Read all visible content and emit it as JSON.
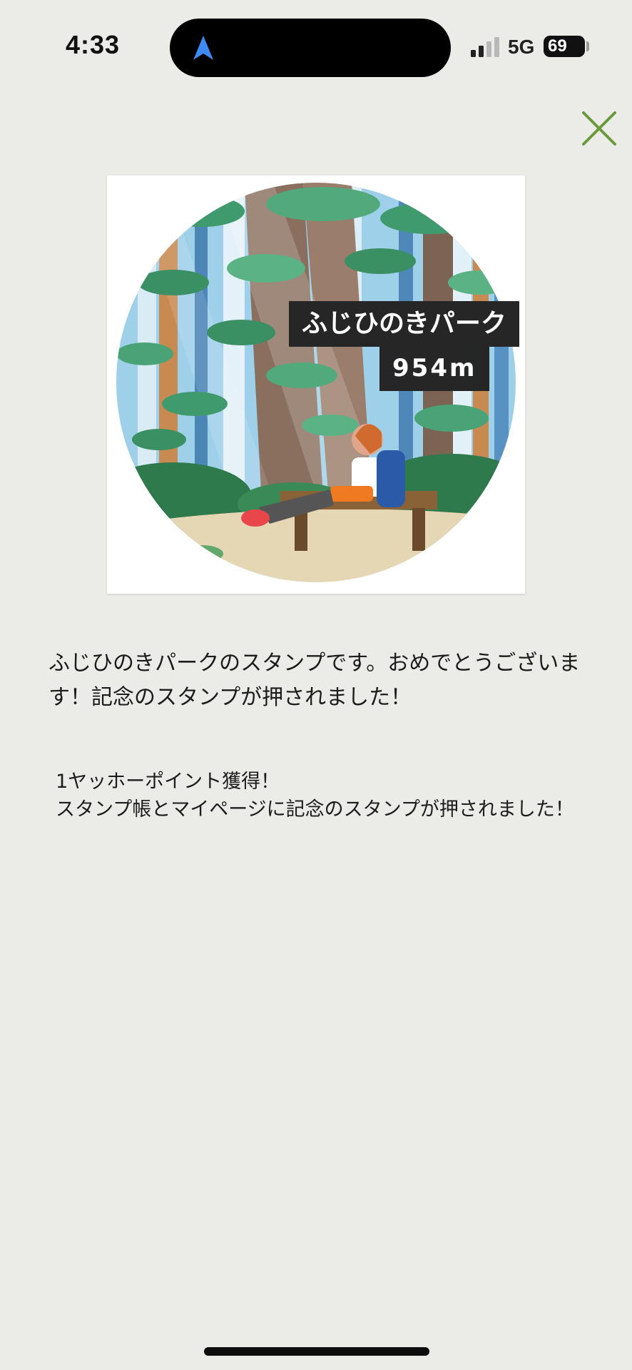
{
  "status_bar": {
    "time": "4:33",
    "network": "5G",
    "battery_level": "69"
  },
  "colors": {
    "background": "#ebebe7",
    "close_icon": "#6a9a3a",
    "label_bg": "#262626"
  },
  "icons": {
    "close": "close-icon",
    "navigation": "navigation-arrow-icon",
    "signal": "signal-icon"
  },
  "stamp": {
    "place_name": "ふじひのきパーク",
    "elevation": "954m"
  },
  "messages": {
    "main": "ふじひのきパークのスタンプです。おめでとうございます！記念のスタンプが押されました！",
    "points_line1": "1ヤッホーポイント獲得！",
    "points_line2": "スタンプ帳とマイページに記念のスタンプが押されました！"
  }
}
